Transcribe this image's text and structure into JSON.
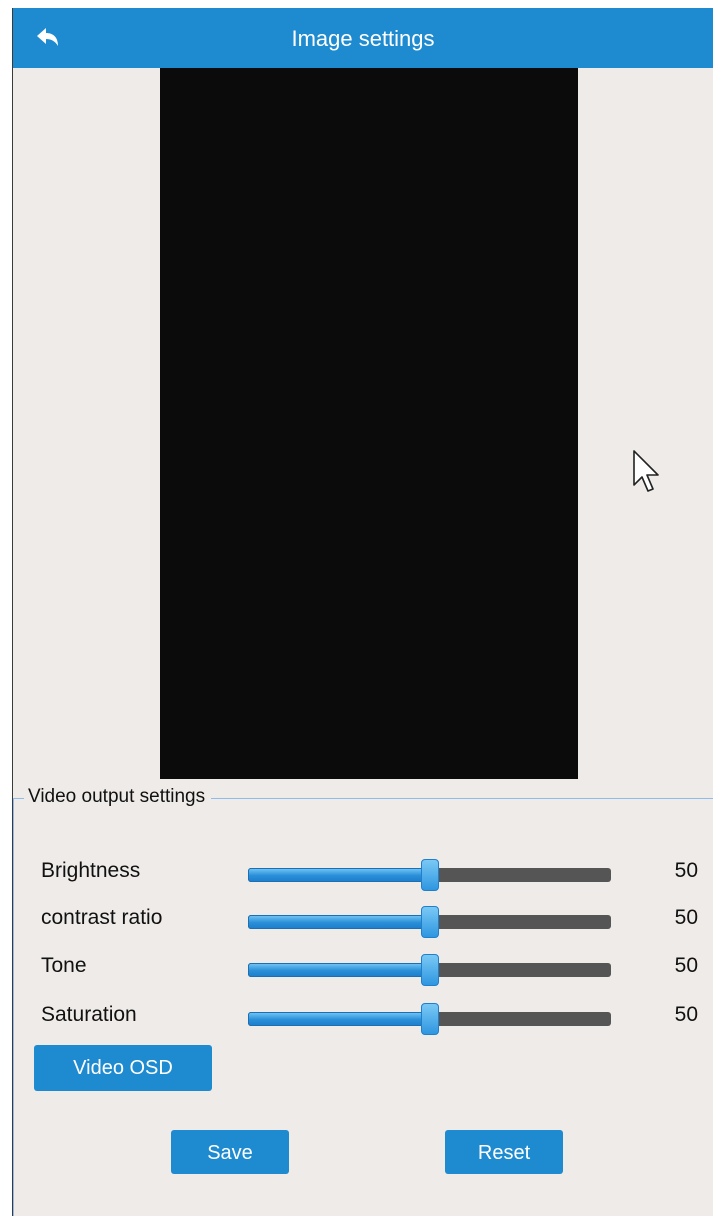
{
  "header": {
    "title": "Image settings",
    "back_icon": "undo-arrow-icon"
  },
  "video_output": {
    "legend": "Video output settings",
    "sliders": [
      {
        "label": "Brightness",
        "value": "50",
        "percent": 50
      },
      {
        "label": "contrast ratio",
        "value": "50",
        "percent": 50
      },
      {
        "label": "Tone",
        "value": "50",
        "percent": 50
      },
      {
        "label": "Saturation",
        "value": "50",
        "percent": 50
      }
    ],
    "osd_button": "Video OSD"
  },
  "actions": {
    "save": "Save",
    "reset": "Reset"
  },
  "colors": {
    "accent": "#1e8bd1",
    "background": "#eeebe8",
    "video_bg": "#0b0b0b",
    "track": "#555555"
  }
}
